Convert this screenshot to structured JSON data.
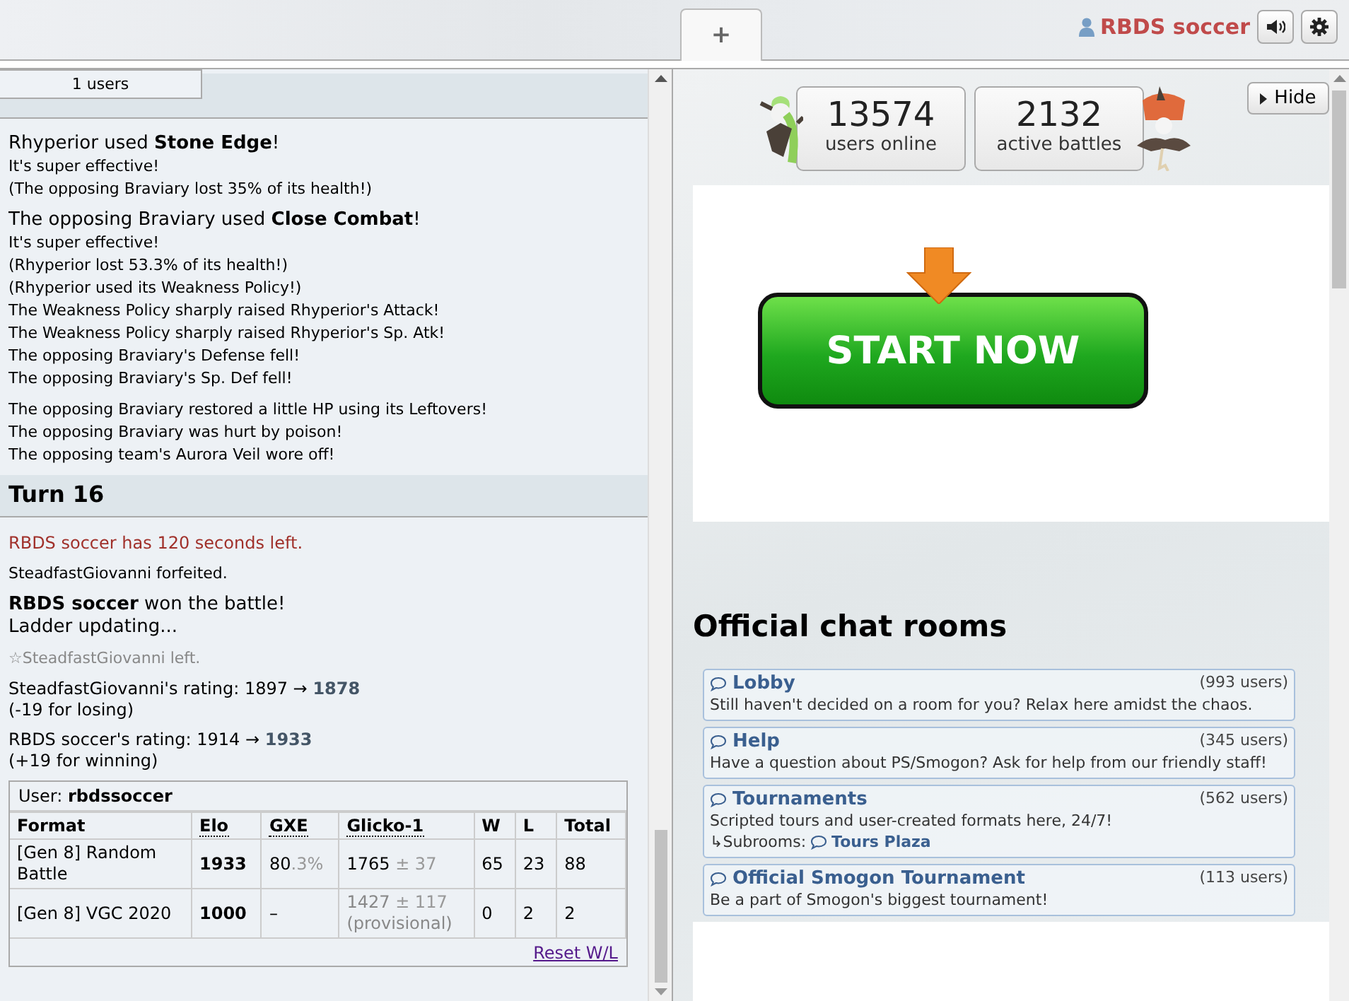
{
  "top_bar": {
    "new_tab": "+",
    "username": "RBDS soccer"
  },
  "battle_log": {
    "users_count": "1 users",
    "blocks": [
      {
        "kind": "turn_cut"
      },
      {
        "kind": "message",
        "lines": [
          {
            "kind": "major",
            "text": "Rhyperior used **Stone Edge**!"
          },
          {
            "kind": "minor",
            "text": "It's super effective!"
          },
          {
            "kind": "minor",
            "text": "(The opposing Braviary lost 35% of its health!)"
          }
        ]
      },
      {
        "kind": "message",
        "lines": [
          {
            "kind": "major",
            "text": "The opposing Braviary used **Close Combat**!"
          },
          {
            "kind": "minor",
            "text": "It's super effective!"
          },
          {
            "kind": "minor",
            "text": "(Rhyperior lost 53.3% of its health!)"
          },
          {
            "kind": "minor",
            "text": "(Rhyperior used its Weakness Policy!)"
          },
          {
            "kind": "minor",
            "text": "The Weakness Policy sharply raised Rhyperior's Attack!"
          },
          {
            "kind": "minor",
            "text": "The Weakness Policy sharply raised Rhyperior's Sp. Atk!"
          },
          {
            "kind": "minor",
            "text": "The opposing Braviary's Defense fell!"
          },
          {
            "kind": "minor",
            "text": "The opposing Braviary's Sp. Def fell!"
          }
        ]
      },
      {
        "kind": "message",
        "lines": [
          {
            "kind": "minor",
            "text": "The opposing Braviary restored a little HP using its Leftovers!"
          },
          {
            "kind": "minor",
            "text": "The opposing Braviary was hurt by poison!"
          },
          {
            "kind": "minor",
            "text": "The opposing team's Aurora Veil wore off!"
          }
        ]
      },
      {
        "kind": "turn",
        "text": "Turn 16"
      },
      {
        "kind": "message",
        "lines": [
          {
            "kind": "timer",
            "text": "RBDS soccer has 120 seconds left."
          }
        ]
      },
      {
        "kind": "message",
        "lines": [
          {
            "kind": "minor",
            "text": "SteadfastGiovanni forfeited."
          }
        ]
      },
      {
        "kind": "message",
        "lines": [
          {
            "kind": "major",
            "text": "**RBDS soccer** won the battle!"
          },
          {
            "kind": "major",
            "text": "Ladder updating..."
          }
        ]
      },
      {
        "kind": "message",
        "lines": [
          {
            "kind": "notice",
            "text": "☆SteadfastGiovanni left."
          }
        ]
      },
      {
        "kind": "message",
        "lines": [
          {
            "kind": "rating",
            "text": "SteadfastGiovanni's rating: 1897 → **1878**"
          },
          {
            "kind": "rating",
            "text": "(-19 for losing)"
          }
        ]
      },
      {
        "kind": "message",
        "lines": [
          {
            "kind": "rating",
            "text": "RBDS soccer's rating: 1914 → **1933**"
          },
          {
            "kind": "rating",
            "text": "(+19 for winning)"
          }
        ]
      }
    ],
    "rating_table": {
      "user": "User: **rbdssoccer**",
      "columns": [
        {
          "label": "Format",
          "dotted": false
        },
        {
          "label": "Elo",
          "dotted": true
        },
        {
          "label": "GXE",
          "dotted": true
        },
        {
          "label": "Glicko-1",
          "dotted": true
        },
        {
          "label": "W",
          "dotted": false
        },
        {
          "label": "L",
          "dotted": false
        },
        {
          "label": "Total",
          "dotted": false
        }
      ],
      "rows": [
        {
          "format": "[Gen 8] Random Battle",
          "elo": "1933",
          "gxe": "80",
          "gxe_decimal": ".3%",
          "glicko": "1765",
          "deviation": "± 37",
          "provisional": false,
          "w": "65",
          "l": "23",
          "total": "88"
        },
        {
          "format": "[Gen 8] VGC 2020",
          "elo": "1000",
          "gxe": "–",
          "glicko": "1427",
          "deviation": "± 117",
          "provisional": true,
          "provisional_note": "(provisional)",
          "w": "0",
          "l": "2",
          "total": "2"
        }
      ],
      "reset_link": "Reset W/L"
    }
  },
  "home": {
    "stats": [
      {
        "value": "13574",
        "label": "users online"
      },
      {
        "value": "2132",
        "label": "active battles"
      }
    ],
    "hide_button": "Hide",
    "ad": {
      "button_text": "START NOW"
    },
    "rooms_heading": "Official chat rooms",
    "rooms": [
      {
        "name": "Lobby",
        "users": "(993 users)",
        "description": "Still haven't decided on a room for you? Relax here amidst the chaos."
      },
      {
        "name": "Help",
        "users": "(345 users)",
        "description": "Have a question about PS/Smogon? Ask for help from our friendly staff!"
      },
      {
        "name": "Tournaments",
        "users": "(562 users)",
        "description": "Scripted tours and user-created formats here, 24/7!",
        "subrooms_label": "↳Subrooms:",
        "subrooms": [
          "Tours Plaza"
        ]
      },
      {
        "name": "Official Smogon Tournament",
        "users": "(113 users)",
        "description": "Be a part of Smogon's biggest tournament!"
      }
    ]
  }
}
